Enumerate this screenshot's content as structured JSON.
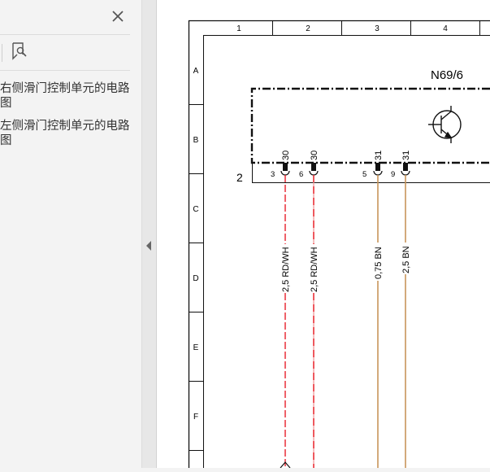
{
  "sidebar": {
    "bookmarks": [
      {
        "label": "右侧滑门控制单元的电路图"
      },
      {
        "label": "左侧滑门控制单元的电路图"
      }
    ]
  },
  "diagram": {
    "columns": [
      "1",
      "2",
      "3",
      "4"
    ],
    "rows": [
      "A",
      "B",
      "C",
      "D",
      "E",
      "F"
    ],
    "component_id": "N69/6",
    "connector_id": "2",
    "pins": [
      {
        "pin": "3",
        "terminal": "30",
        "wire": "2,5 RD/WH"
      },
      {
        "pin": "6",
        "terminal": "30",
        "wire": "2,5 RD/WH"
      },
      {
        "pin": "5",
        "terminal": "31",
        "wire": "0,75 BN"
      },
      {
        "pin": "9",
        "terminal": "31",
        "wire": "2,5 BN"
      }
    ]
  },
  "colors": {
    "wire_red": "#e8202a",
    "wire_red_light": "#f2a3a3",
    "wire_brown": "#c8955a"
  }
}
